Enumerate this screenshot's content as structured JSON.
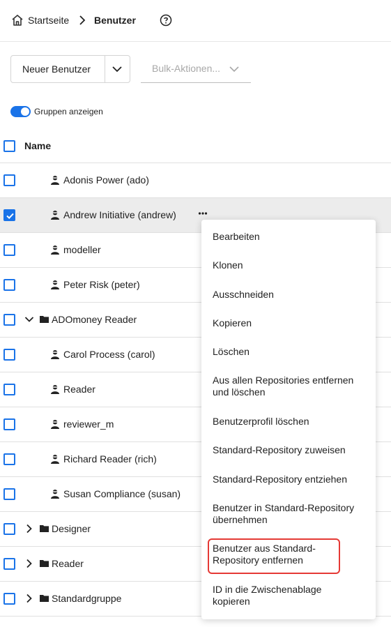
{
  "breadcrumb": {
    "home": "Startseite",
    "current": "Benutzer"
  },
  "toolbar": {
    "new_user": "Neuer Benutzer",
    "bulk_placeholder": "Bulk-Aktionen..."
  },
  "toggle": {
    "label": "Gruppen anzeigen",
    "on": true
  },
  "table": {
    "header": "Name",
    "rows": [
      {
        "type": "user",
        "label": "Adonis Power (ado)",
        "checked": false
      },
      {
        "type": "user",
        "label": "Andrew Initiative (andrew)",
        "checked": true
      },
      {
        "type": "user",
        "label": "modeller",
        "checked": false
      },
      {
        "type": "user",
        "label": "Peter Risk (peter)",
        "checked": false
      },
      {
        "type": "group",
        "label": "ADOmoney Reader",
        "expanded": true
      },
      {
        "type": "user",
        "label": "Carol Process (carol)",
        "checked": false
      },
      {
        "type": "user",
        "label": "Reader",
        "checked": false
      },
      {
        "type": "user",
        "label": "reviewer_m",
        "checked": false
      },
      {
        "type": "user",
        "label": "Richard Reader (rich)",
        "checked": false
      },
      {
        "type": "user",
        "label": "Susan Compliance (susan)",
        "checked": false
      },
      {
        "type": "group",
        "label": "Designer",
        "expanded": false
      },
      {
        "type": "group",
        "label": "Reader",
        "expanded": false
      },
      {
        "type": "group",
        "label": "Standardgruppe",
        "expanded": false
      }
    ]
  },
  "context_menu": {
    "items": [
      {
        "line1": "Bearbeiten",
        "line2": ""
      },
      {
        "line1": "Klonen",
        "line2": ""
      },
      {
        "line1": "Ausschneiden",
        "line2": ""
      },
      {
        "line1": "Kopieren",
        "line2": ""
      },
      {
        "line1": "Löschen",
        "line2": ""
      },
      {
        "line1": "Aus allen Repositories entfernen",
        "line2": "und löschen"
      },
      {
        "line1": "Benutzerprofil löschen",
        "line2": ""
      },
      {
        "line1": "Standard-Repository zuweisen",
        "line2": ""
      },
      {
        "line1": "Standard-Repository entziehen",
        "line2": ""
      },
      {
        "line1": "Benutzer in Standard-Repository",
        "line2": "übernehmen"
      },
      {
        "line1": "Benutzer aus Standard-",
        "line2": "Repository entfernen"
      },
      {
        "line1": "ID in die Zwischenablage",
        "line2": "kopieren"
      }
    ],
    "highlighted_index": 10
  },
  "colors": {
    "accent": "#1a73e8",
    "highlight_border": "#e53935",
    "selected_row": "#ececec"
  }
}
